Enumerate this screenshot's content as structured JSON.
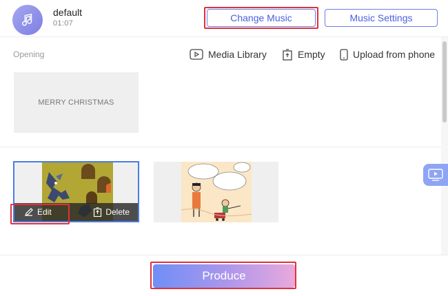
{
  "music": {
    "name": "default",
    "duration": "01:07",
    "change_label": "Change Music",
    "settings_label": "Music Settings"
  },
  "opening": {
    "label": "Opening",
    "card_text": "MERRY CHRISTMAS",
    "tools": {
      "media_library": "Media Library",
      "empty": "Empty",
      "upload": "Upload from phone"
    }
  },
  "clips": {
    "edit_label": "Edit",
    "delete_label": "Delete"
  },
  "footer": {
    "produce_label": "Produce"
  },
  "colors": {
    "accent": "#4a5fe0",
    "highlight": "#e0303a",
    "selected_border": "#4b7be5"
  },
  "icons": [
    "music-note-icon",
    "media-library-icon",
    "trash-icon",
    "phone-icon",
    "pencil-icon",
    "delete-icon",
    "preview-icon"
  ]
}
